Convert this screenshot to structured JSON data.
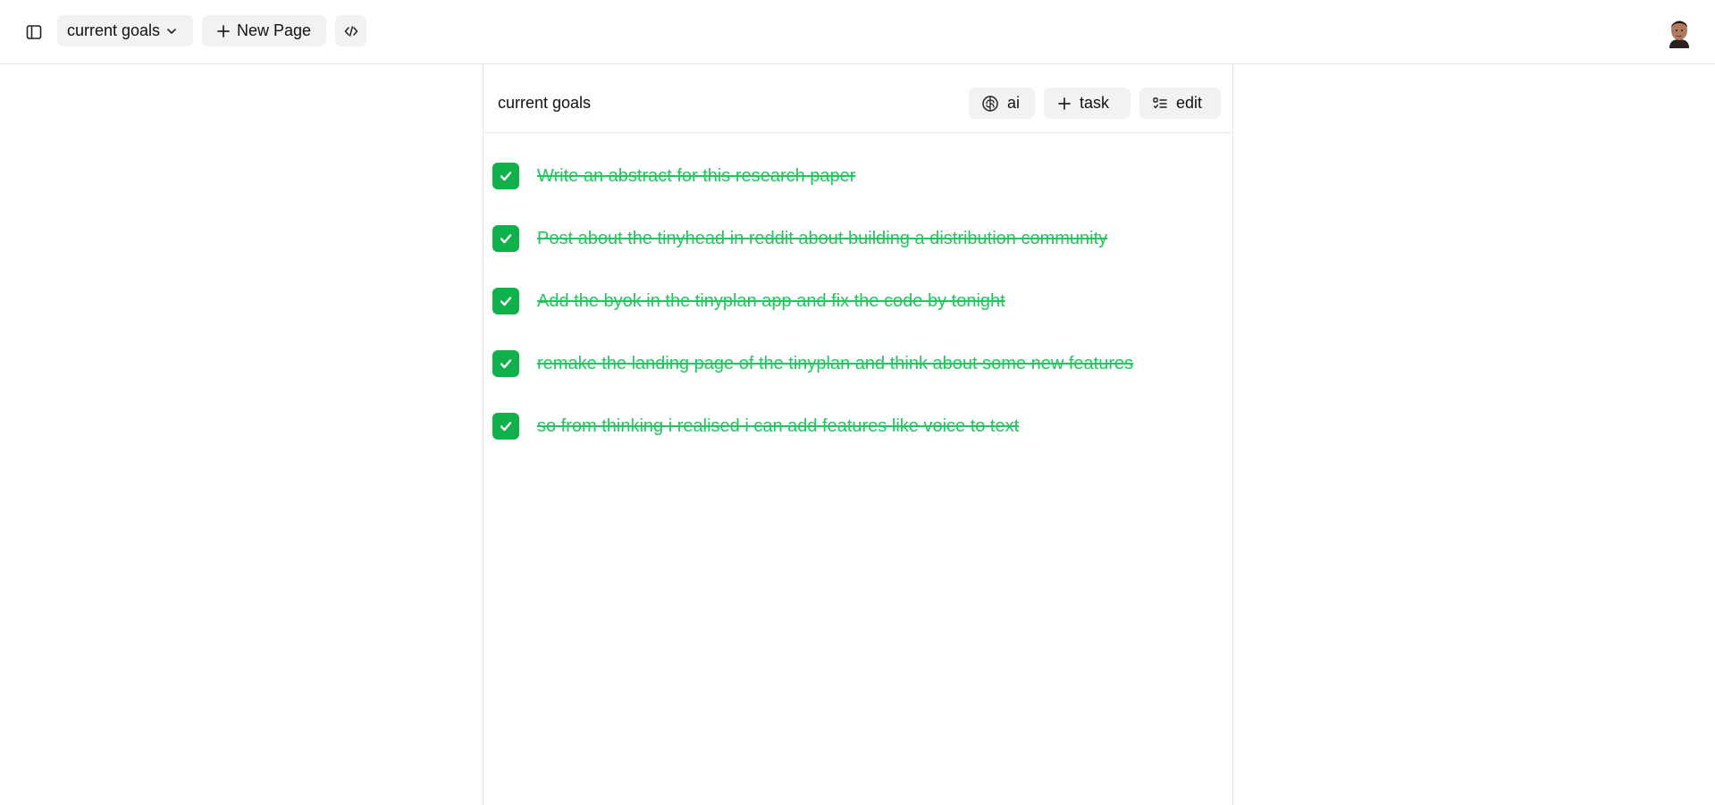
{
  "topbar": {
    "sidebar_toggle_icon": "sidebar-panel-icon",
    "page_selector": {
      "label": "current goals",
      "icon": "chevron-down-icon"
    },
    "new_page": {
      "label": "New Page",
      "icon": "plus-icon"
    },
    "code_icon": "code-icon",
    "avatar_icon": "user-avatar"
  },
  "panel": {
    "title": "current goals",
    "buttons": {
      "ai": {
        "label": "ai",
        "icon": "brain-icon"
      },
      "task": {
        "label": "task",
        "icon": "plus-icon"
      },
      "edit": {
        "label": "edit",
        "icon": "checklist-edit-icon"
      }
    },
    "tasks": [
      {
        "text": "Write an abstract for this research paper",
        "done": true
      },
      {
        "text": "Post about the tinyhead in reddit about building a distribution community",
        "done": true
      },
      {
        "text": "Add the byok in the tinyplan app and fix the code by tonight",
        "done": true
      },
      {
        "text": "remake the landing page of the tinyplan and think about some new features",
        "done": true
      },
      {
        "text": "so  from thinking i realised i can add features like voice to text ",
        "done": true
      }
    ]
  },
  "colors": {
    "checkbox_bg": "#10b04a",
    "done_text": "#22c55e",
    "button_bg": "#f1f2f4",
    "border": "#e5e7eb"
  }
}
